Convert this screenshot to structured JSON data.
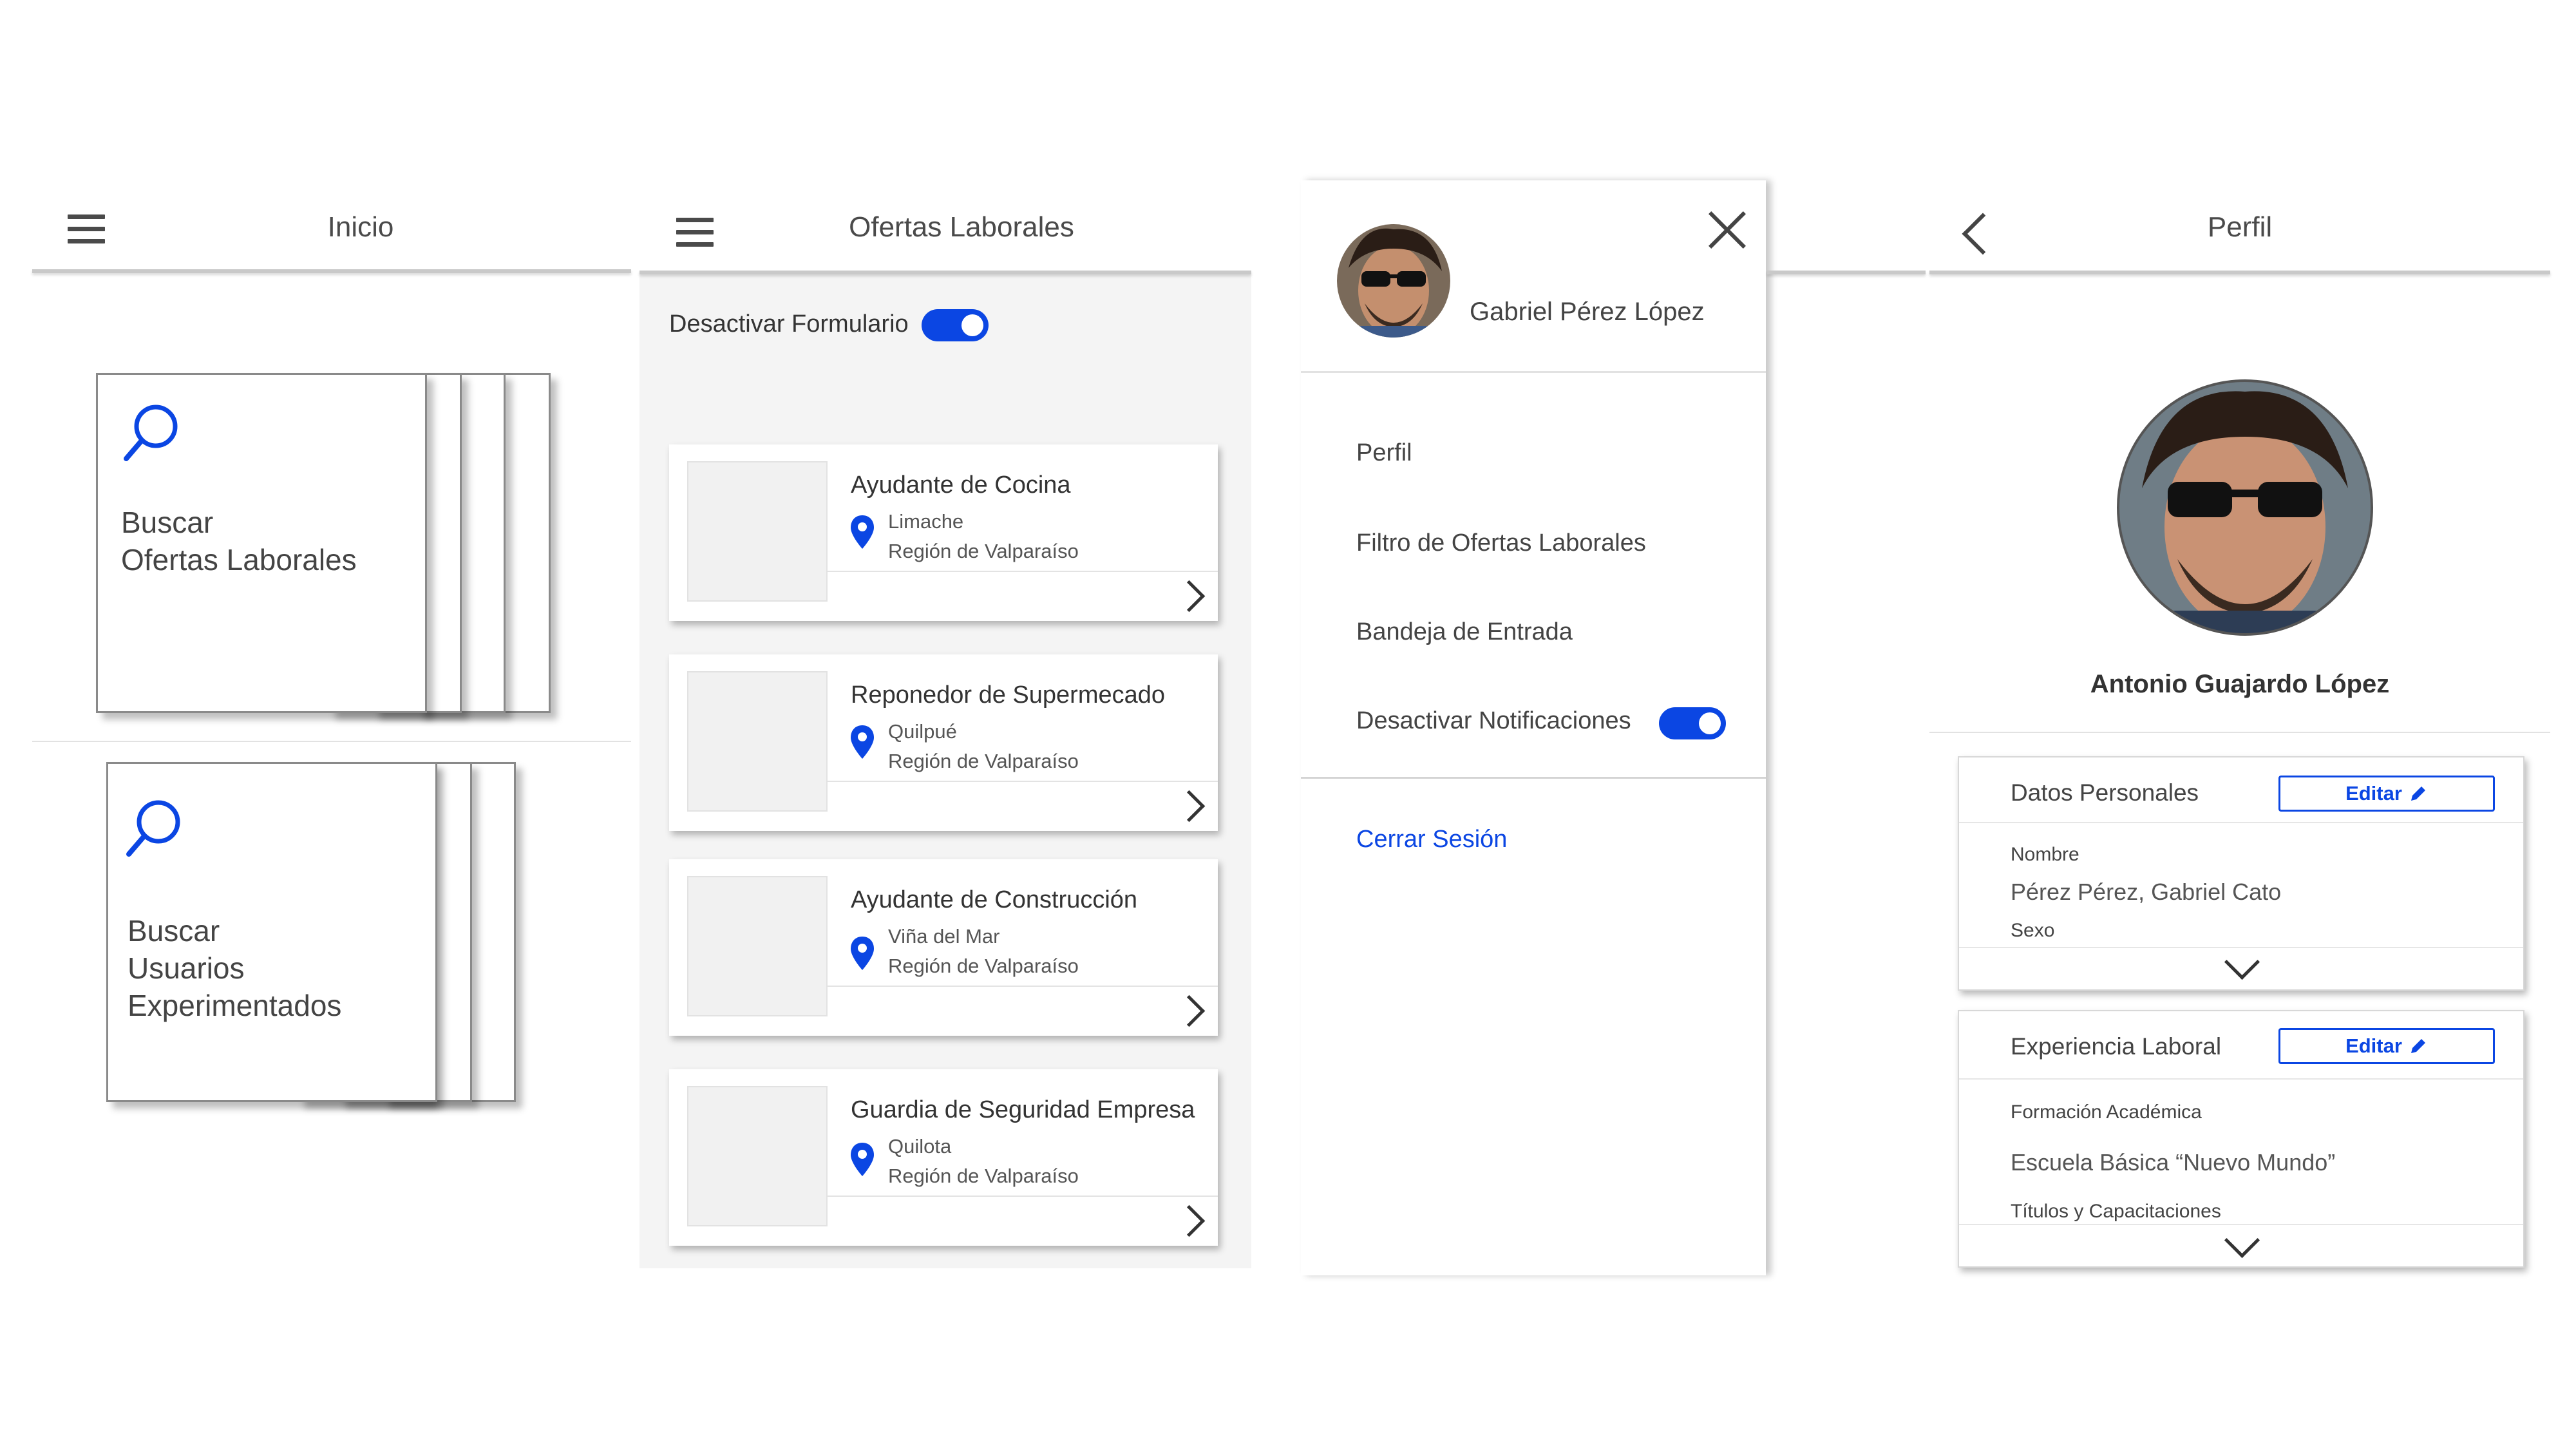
{
  "screen1": {
    "title": "Inicio",
    "card1": {
      "line1": "Buscar",
      "line2": "Ofertas Laborales"
    },
    "card2": {
      "line1": "Buscar",
      "line2": "Usuarios",
      "line3": "Experimentados"
    }
  },
  "screen2": {
    "title": "Ofertas Laborales",
    "toggle_label": "Desactivar Formulario",
    "jobs": [
      {
        "title": "Ayudante de Cocina",
        "city": "Limache",
        "region": "Región de Valparaíso"
      },
      {
        "title": "Reponedor de Supermecado",
        "city": "Quilpué",
        "region": "Región de Valparaíso"
      },
      {
        "title": "Ayudante de Construcción",
        "city": "Viña del Mar",
        "region": "Región de Valparaíso"
      },
      {
        "title": "Guardia de Seguridad Empresa",
        "city": "Quilota",
        "region": "Región de Valparaíso"
      }
    ]
  },
  "screen3": {
    "user_name": "Gabriel Pérez López",
    "menu": {
      "profile": "Perfil",
      "filter": "Filtro de Ofertas Laborales",
      "inbox": "Bandeja de Entrada",
      "notifications": "Desactivar Notificaciones",
      "logout": "Cerrar Sesión"
    }
  },
  "screen4": {
    "title": "Perfil",
    "user_name": "Antonio Guajardo López",
    "personal": {
      "title": "Datos Personales",
      "edit_label": "Editar",
      "name_label": "Nombre",
      "name_value": "Pérez Pérez, Gabriel Cato",
      "sex_label": "Sexo"
    },
    "experience": {
      "title": "Experiencia Laboral",
      "edit_label": "Editar",
      "education_label": "Formación Académica",
      "education_value": "Escuela Básica “Nuevo Mundo”",
      "titles_label": "Títulos y Capacitaciones"
    }
  },
  "colors": {
    "accent": "#0b46e3",
    "header_line": "#c9c9c9",
    "panel_bg": "#f4f4f4"
  }
}
